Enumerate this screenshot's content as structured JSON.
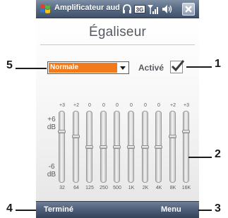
{
  "titlebar": {
    "app_title": "Amplificateur audi",
    "network_badge": "3G",
    "icons": [
      "windows-start-icon",
      "headphone-icon",
      "3g-icon",
      "signal-icon",
      "volume-icon",
      "close-icon"
    ]
  },
  "page": {
    "title": "Égaliseur"
  },
  "preset": {
    "selected": "Normale",
    "highlight_color": "#f27a1a"
  },
  "enabled": {
    "label": "Activé",
    "checked": true
  },
  "equalizer": {
    "db_top": "+6\ndB",
    "db_bottom": "-6\ndB",
    "bands": [
      {
        "freq": "32",
        "gain": "+3"
      },
      {
        "freq": "64",
        "gain": "+2"
      },
      {
        "freq": "125",
        "gain": "0"
      },
      {
        "freq": "250",
        "gain": "0"
      },
      {
        "freq": "500",
        "gain": "0"
      },
      {
        "freq": "1K",
        "gain": "0"
      },
      {
        "freq": "2K",
        "gain": "0"
      },
      {
        "freq": "4K",
        "gain": "0"
      },
      {
        "freq": "8K",
        "gain": "+2"
      },
      {
        "freq": "16K",
        "gain": "+3"
      }
    ]
  },
  "softkeys": {
    "left": "Terminé",
    "right": "Menu"
  },
  "callouts": {
    "c1": "1",
    "c2": "2",
    "c3": "3",
    "c4": "4",
    "c5": "5"
  }
}
